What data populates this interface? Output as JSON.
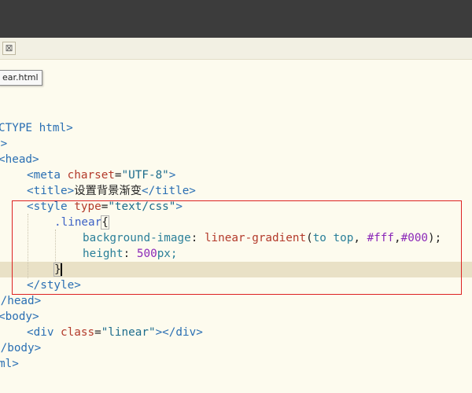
{
  "window": {
    "tab_close": "⊠",
    "tab_tooltip": "ear.html"
  },
  "code": {
    "l1_text": "CTYPE html>",
    "l2_text": "l>",
    "l3_tag": "<head>",
    "l4_open": "<meta ",
    "l4_attr": "charset",
    "l4_eq": "=",
    "l4_val": "\"UTF-8\"",
    "l4_close": ">",
    "l5_open": "<title>",
    "l5_text": "设置背景渐变",
    "l5_close": "</title>",
    "l6_open": "<style ",
    "l6_attr": "type",
    "l6_eq": "=",
    "l6_val": "\"text/css\"",
    "l6_close": ">",
    "l7_sel": ".linear",
    "l7_brace": "{",
    "l8_prop": "background-image",
    "l8_colon": ": ",
    "l8_fn": "linear-gradient",
    "l8_paren": "(",
    "l8_kw1": "to",
    "l8_kw2": "top",
    "l8_comma1": ", ",
    "l8_c1": "#fff",
    "l8_comma2": ",",
    "l8_c2": "#000",
    "l8_end": ");",
    "l9_prop": "height",
    "l9_colon": ": ",
    "l9_num": "500",
    "l9_unit": "px;",
    "l10_brace": "}",
    "l11_tag": "</style>",
    "l12_tag": "</head>",
    "l13_tag": "<body>",
    "l14_open": "<div ",
    "l14_attr": "class",
    "l14_eq": "=",
    "l14_val": "\"linear\"",
    "l14_close": "></div>",
    "l15_tag": "</body>",
    "l16_tag": "ml>"
  }
}
